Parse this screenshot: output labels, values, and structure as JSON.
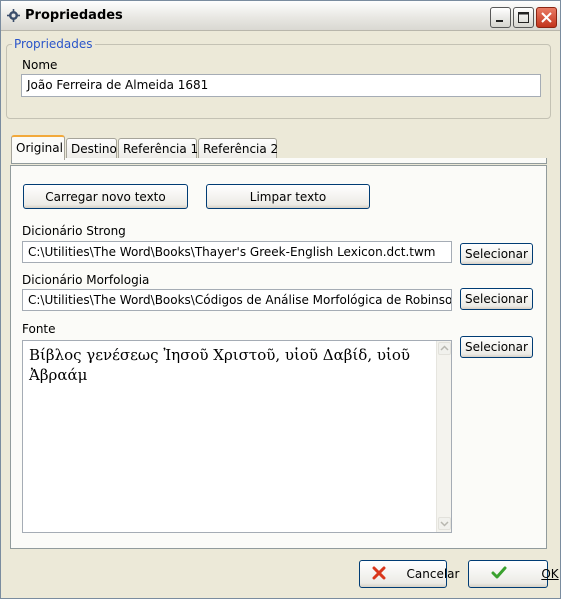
{
  "window": {
    "title": "Propriedades",
    "icon": "gear-icon"
  },
  "properties_group": {
    "legend": "Propriedades",
    "name_label": "Nome",
    "name_value": "João Ferreira de Almeida 1681"
  },
  "tabs": [
    {
      "label": "Original",
      "active": true
    },
    {
      "label": "Destino",
      "active": false
    },
    {
      "label": "Referência 1",
      "active": false
    },
    {
      "label": "Referência 2",
      "active": false
    }
  ],
  "original_tab": {
    "load_button": "Carregar novo texto",
    "clear_button": "Limpar texto",
    "strong_label": "Dicionário Strong",
    "strong_value": "C:\\Utilities\\The Word\\Books\\Thayer's Greek-English Lexicon.dct.twm",
    "strong_select": "Selecionar",
    "morph_label": "Dicionário Morfologia",
    "morph_value": "C:\\Utilities\\The Word\\Books\\Códigos de Análise Morfológica de Robinson.dct.",
    "morph_select": "Selecionar",
    "font_label": "Fonte",
    "font_text": "Βίβλος γενέσεως Ἰησοῦ Χριστοῦ, υἱοῦ Δαβίδ, υἱοῦ Ἀβραάμ",
    "font_select": "Selecionar"
  },
  "footer": {
    "cancel_button": "Cancelar",
    "ok_button": "OK"
  },
  "colors": {
    "legend": "#2a55c9",
    "cancel_icon": "#d9361b",
    "ok_icon": "#3aa12e",
    "tab_highlight": "#f2a93b"
  }
}
